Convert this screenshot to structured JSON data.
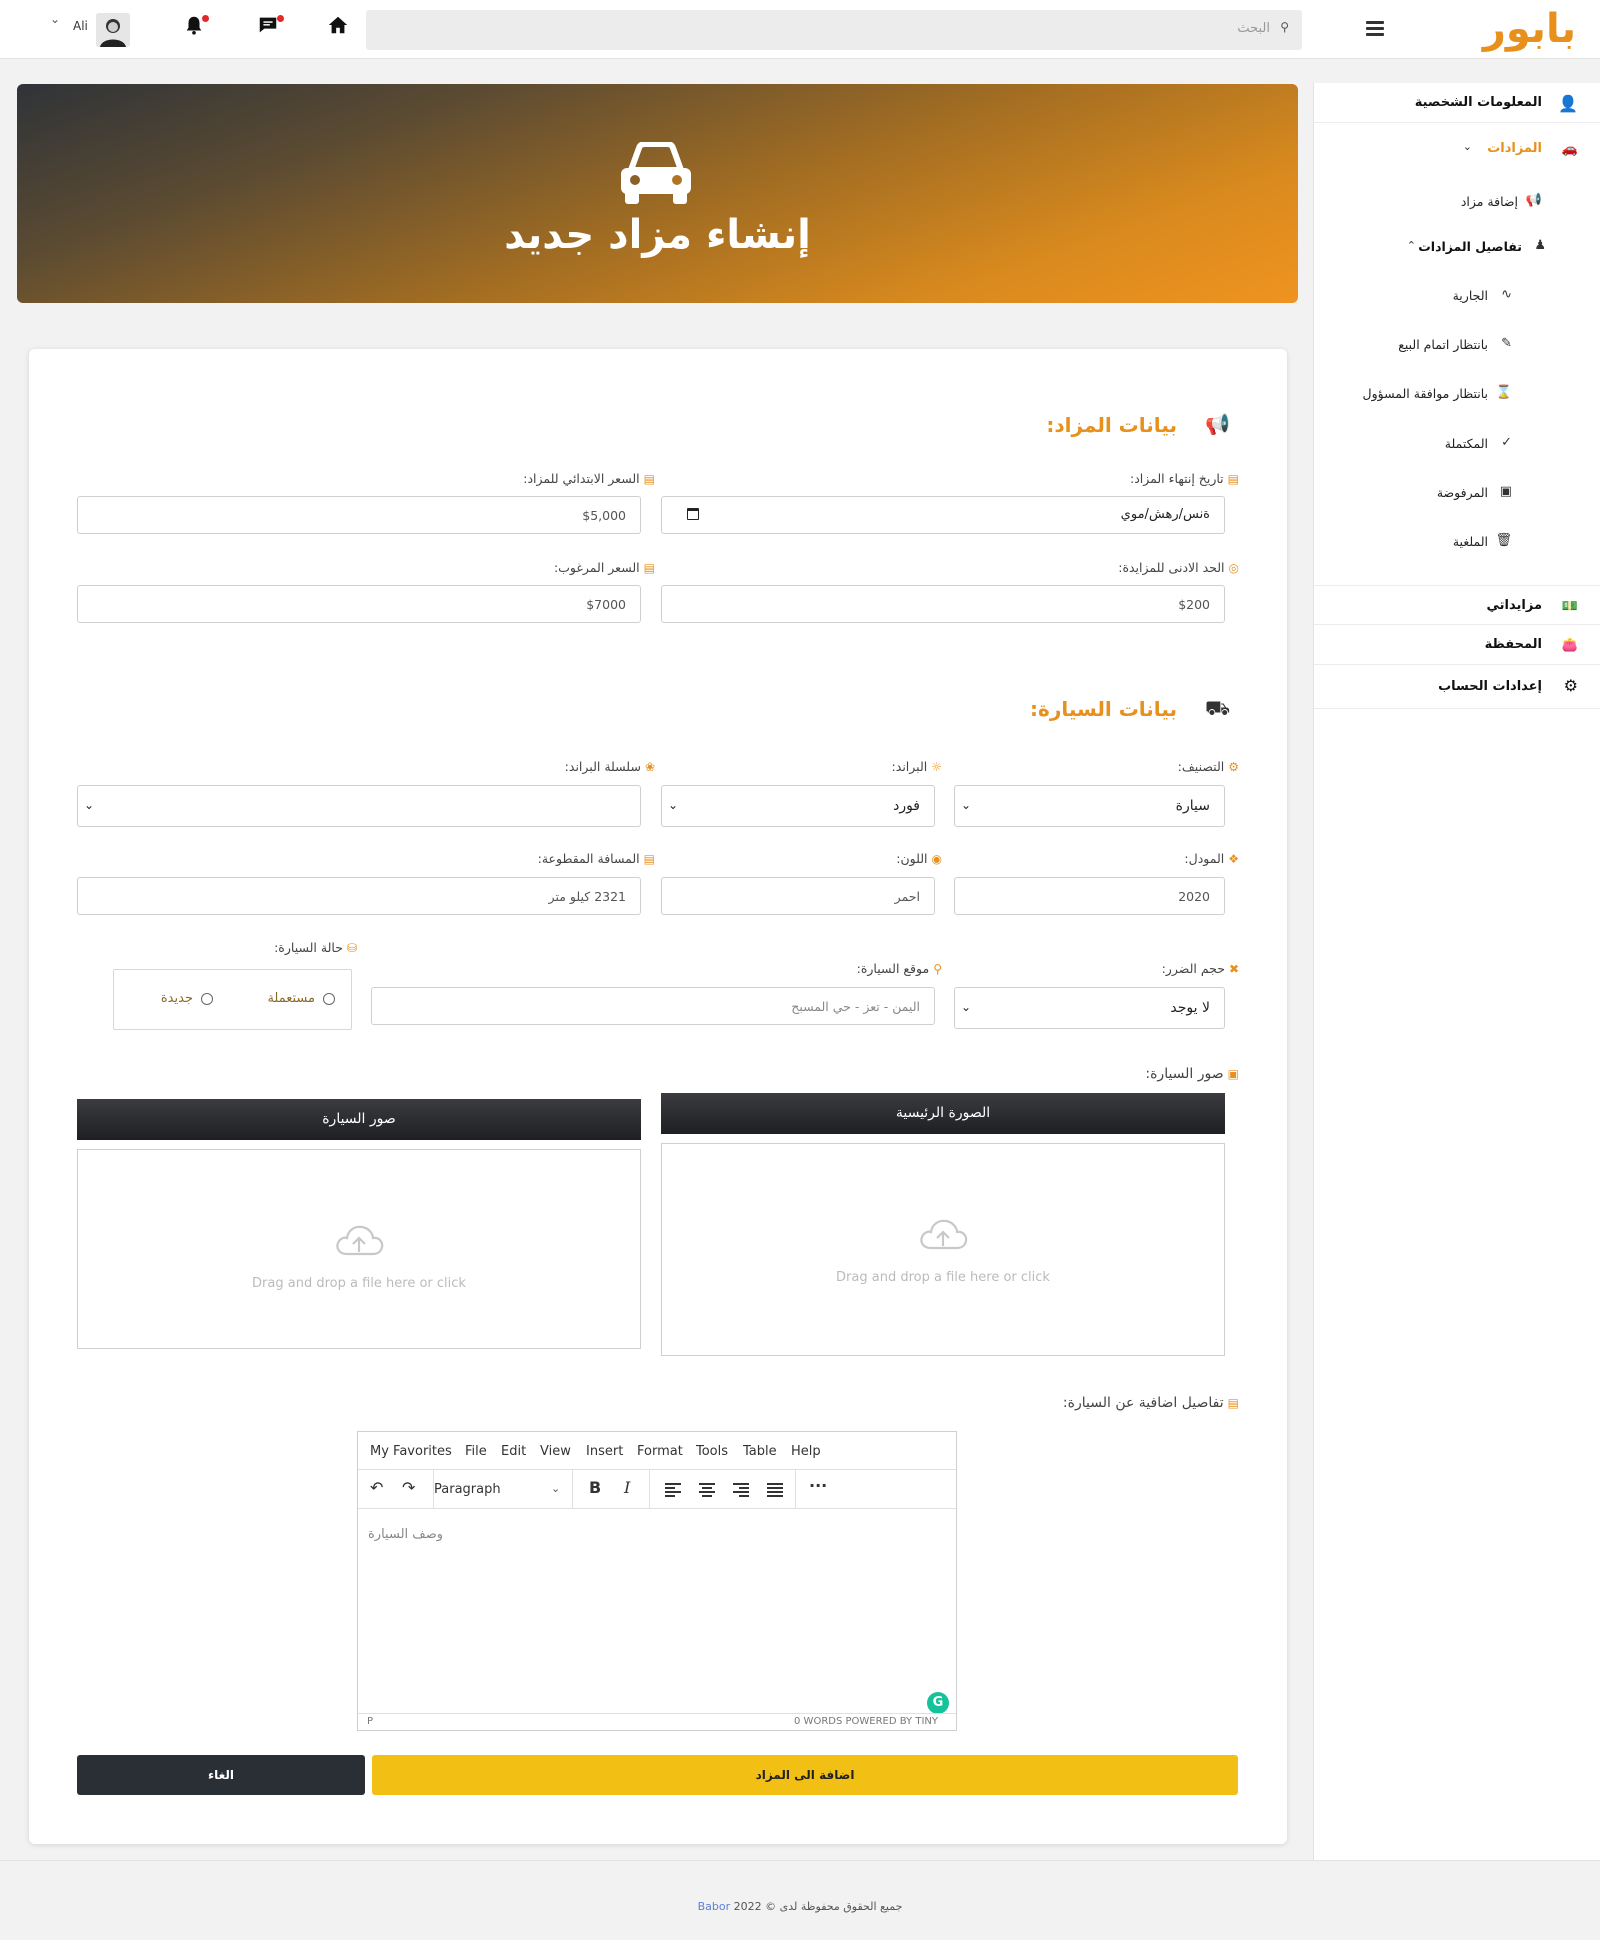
{
  "topbar": {
    "logo": "بابور",
    "search_placeholder": "البحث",
    "username": "Ali",
    "icons": [
      "menu-icon",
      "search-icon",
      "home-icon",
      "chat-icon",
      "bell-icon",
      "chevron-down-icon"
    ]
  },
  "sidebar": {
    "profile": "المعلومات الشخصية",
    "auctions": "المزادات",
    "add_auction": "إضافة مزاد",
    "auction_details": "تفاصيل المزادات",
    "status_items": [
      "الجارية",
      "بانتظار اتمام البيع",
      "بانتظار موافقة المسؤول",
      "المكتملة",
      "المرفوضة",
      "الملغية"
    ],
    "my_bids": "مزايداتي",
    "wallet": "المحفظة",
    "account_settings": "إعدادات الحساب"
  },
  "hero": {
    "title": "إنشاء مزاد جديد"
  },
  "auction_section": {
    "title": "بيانات المزاد:",
    "end_date_label": "تاريخ إنتهاء المزاد:",
    "end_date_value": "ةنس/رهش/موي",
    "start_price_label": "السعر الابتدائي للمزاد:",
    "start_price_value": "$5,000",
    "min_bid_label": "الحد الادنى للمزايدة:",
    "min_bid_value": "$200",
    "desired_price_label": "السعر المرغوب:",
    "desired_price_value": "$7000"
  },
  "car_section": {
    "title": "بيانات السيارة:",
    "category_label": "التصنيف:",
    "category_value": "سيارة",
    "brand_label": "البراند:",
    "brand_value": "فورد",
    "series_label": "سلسلة البراند:",
    "series_value": "",
    "model_label": "المودل:",
    "model_value": "2020",
    "color_label": "اللون:",
    "color_value": "احمر",
    "mileage_label": "المسافة المقطوعة:",
    "mileage_value": "2321 كيلو متر",
    "damage_label": "حجم الضرر:",
    "damage_value": "لا يوجد",
    "location_label": "موقع السيارة:",
    "location_placeholder": "اليمن - تعز - حي المسبح",
    "condition_label": "حالة السيارة:",
    "condition_used": "مستعملة",
    "condition_new": "جديدة",
    "images_label": "صور السيارة:",
    "main_image_header": "الصورة الرئيسية",
    "car_images_header": "صور السيارة",
    "dropzone_text": "Drag and drop a file here or click",
    "details_label": "تفاصيل اضافية عن السيارة:"
  },
  "editor": {
    "menu": [
      "My Favorites",
      "File",
      "Edit",
      "View",
      "Insert",
      "Format",
      "Tools",
      "Table",
      "Help"
    ],
    "block_format": "Paragraph",
    "placeholder": "وصف السيارة",
    "status_path": "P",
    "status_right": "0 WORDS  POWERED BY TINY"
  },
  "actions": {
    "submit": "اضافة الى المزاد",
    "cancel": "الغاء"
  },
  "footer": {
    "text": "جميع الحقوق محفوظة لدى © 2022",
    "brand": "Babor"
  },
  "colors": {
    "accent": "#e8901c",
    "submit": "#f2c014",
    "dark": "#2a2f36"
  }
}
